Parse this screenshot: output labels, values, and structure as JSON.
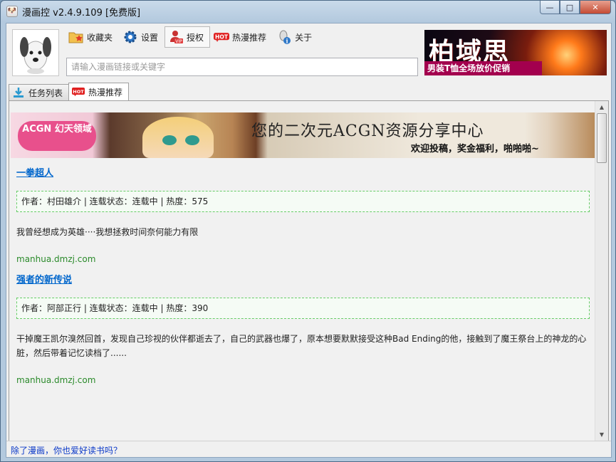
{
  "window": {
    "title": "漫画控 v2.4.9.109 [免费版]",
    "buttons": {
      "minimize": "—",
      "maximize": "□",
      "close": "✕"
    }
  },
  "toolbar": {
    "items": [
      {
        "label": "收藏夹",
        "icon": "folder-star-icon"
      },
      {
        "label": "设置",
        "icon": "gear-icon"
      },
      {
        "label": "授权",
        "icon": "vip-user-icon"
      },
      {
        "label": "热漫推荐",
        "icon": "hot-badge-icon"
      },
      {
        "label": "关于",
        "icon": "info-icon"
      }
    ]
  },
  "search": {
    "placeholder": "请输入漫画链接或关键字",
    "value": ""
  },
  "ad": {
    "headline": "柏域思",
    "tagline": "男装T恤全场放价促销"
  },
  "tabs": [
    {
      "label": "任务列表",
      "icon": "download-icon"
    },
    {
      "label": "热漫推荐",
      "icon": "hot-badge-icon",
      "active": true
    }
  ],
  "banner": {
    "logo": "ACGN 幻天领域",
    "headline": "您的二次元ACGN资源分享中心",
    "sub": "欢迎投稿，奖金福利，啪啪啪~"
  },
  "items": [
    {
      "title": "一拳超人",
      "meta": "作者：村田雄介 | 连载状态：连载中 | 热度：575",
      "desc": "我曾经想成为英雄····我想拯救时间奈何能力有限",
      "source": "manhua.dmzj.com"
    },
    {
      "title": "强者的新传说",
      "meta": "作者：阿部正行 | 连载状态：连载中 | 热度：390",
      "desc": "干掉魔王凯尔溴然回首，发现自己珍视的伙伴都逝去了，自己的武器也爆了，原本想要默默接受这种Bad Ending的他，接触到了魔王祭台上的神龙的心脏，然后带着记忆读档了......",
      "source": "manhua.dmzj.com"
    }
  ],
  "status": {
    "link": "除了漫画，你也爱好读书吗？"
  },
  "colors": {
    "link": "#0066cc",
    "source": "#2a8a2a",
    "meta_border": "#66cc66",
    "hot": "#e02020"
  }
}
